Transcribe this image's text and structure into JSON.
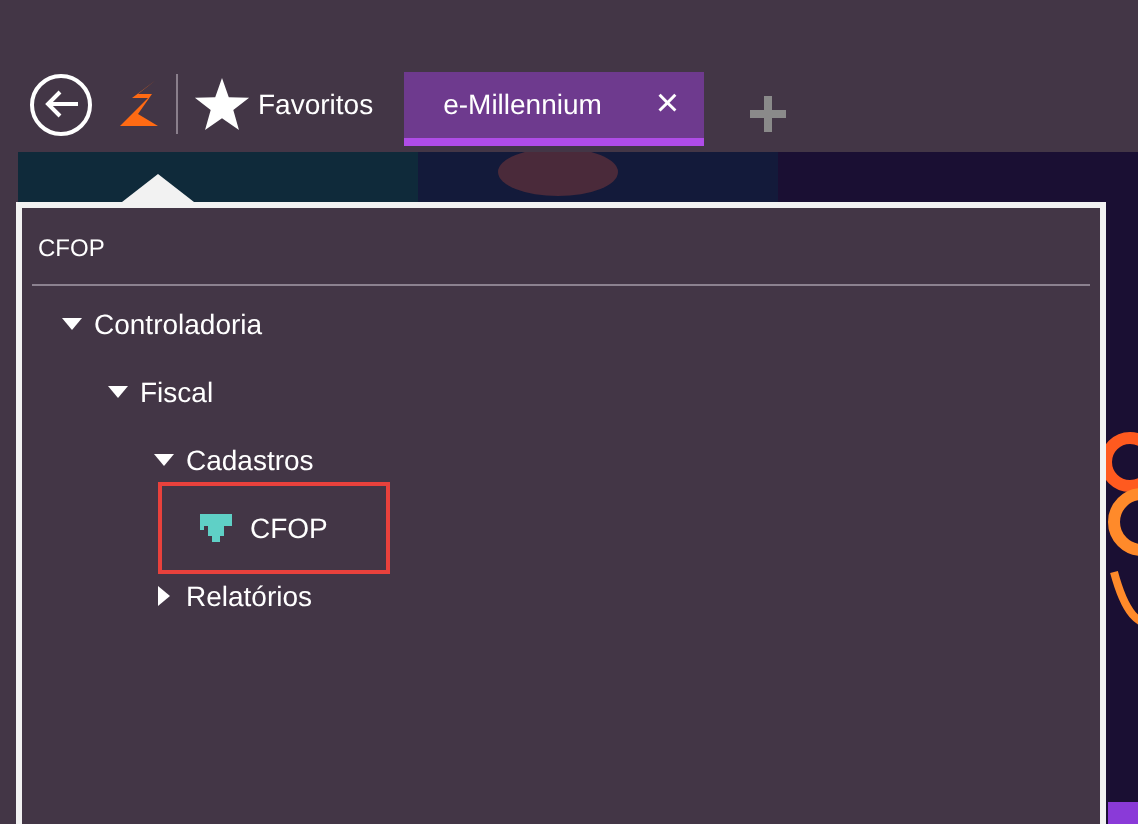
{
  "toolbar": {
    "favorites": "Favoritos"
  },
  "tabs": [
    {
      "label": "e-Millennium",
      "close": "×",
      "selected": true
    }
  ],
  "panel": {
    "title": "CFOP",
    "tree": [
      {
        "label": "Controladoria",
        "kind": "folder",
        "expanded": true,
        "children": [
          {
            "label": "Fiscal",
            "kind": "folder",
            "expanded": true,
            "children": [
              {
                "label": "Cadastros",
                "kind": "folder",
                "expanded": true,
                "children": [
                  {
                    "label": "CFOP",
                    "kind": "item",
                    "highlighted": true
                  }
                ]
              },
              {
                "label": "Relatórios",
                "kind": "folder",
                "expanded": false
              }
            ]
          }
        ]
      }
    ]
  }
}
